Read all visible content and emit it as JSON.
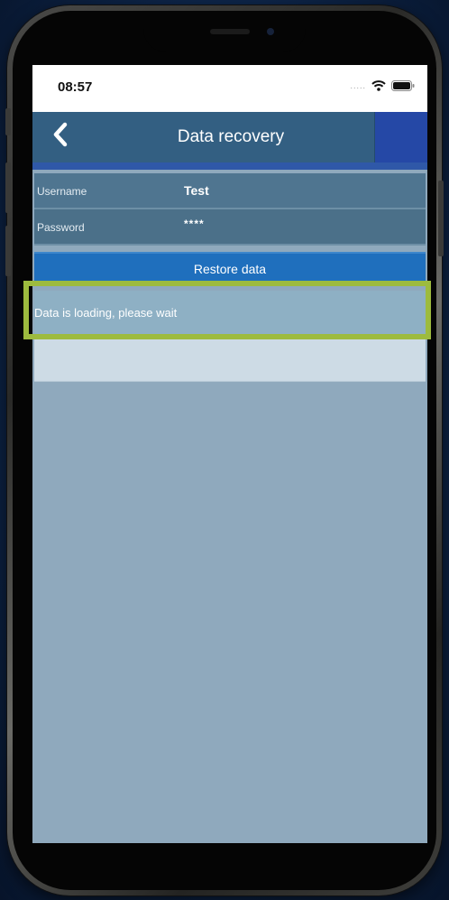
{
  "status_bar": {
    "time": "08:57",
    "signal": "....."
  },
  "navbar": {
    "title": "Data recovery"
  },
  "form": {
    "username_label": "Username",
    "username_value": "Test",
    "password_label": "Password",
    "password_value": "****"
  },
  "restore_button": {
    "label": "Restore data"
  },
  "loading": {
    "message": "Data is loading, please wait"
  },
  "colors": {
    "highlight": "#9dbb3e",
    "button_blue": "#1f6fbd",
    "nav_bar": "#335f82"
  },
  "icons": [
    "back-chevron-icon",
    "wifi-icon",
    "battery-icon"
  ]
}
